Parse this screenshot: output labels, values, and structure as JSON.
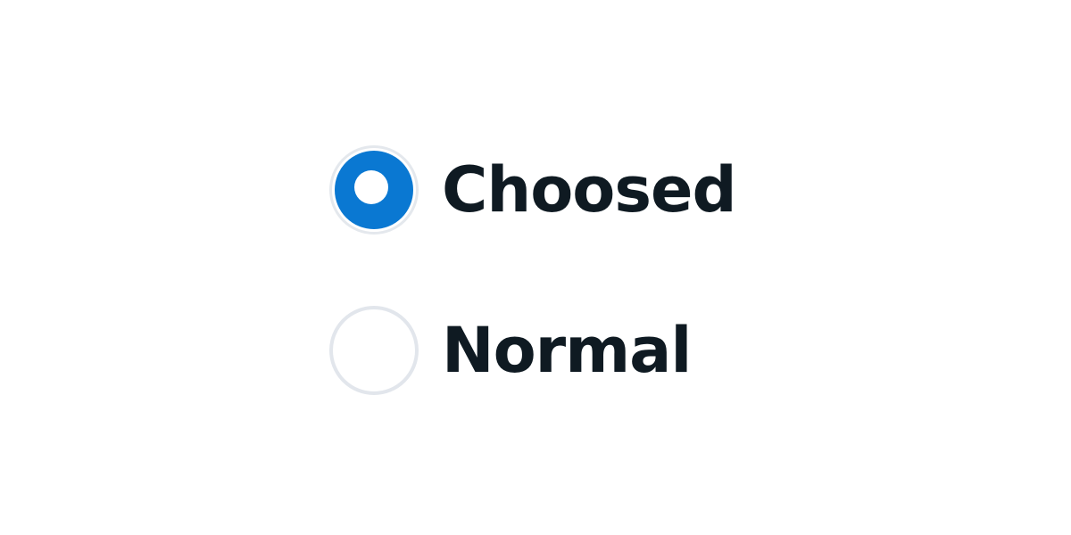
{
  "radio_group": {
    "options": [
      {
        "label": "Choosed",
        "checked": true
      },
      {
        "label": "Normal",
        "checked": false
      }
    ]
  },
  "colors": {
    "checked_fill": "#0a78d2",
    "checked_outer_ring": "#e4e8ed",
    "unchecked_border": "#e2e6ec",
    "label_text": "#0f1a22",
    "background": "#ffffff"
  }
}
